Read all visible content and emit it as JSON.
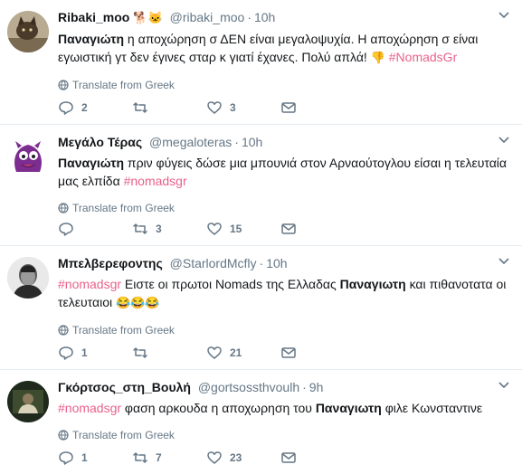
{
  "tweets": [
    {
      "fullname": "Ribaki_moo",
      "fullname_emoji": "🐕🐱",
      "handle": "@ribaki_moo",
      "separator": "·",
      "time": "10h",
      "text_bold_prefix": "Παναγιώτη",
      "text_main": " η αποχώρηση σ ΔΕΝ είναι μεγαλοψυχία. Η αποχώρηση σ είναι εγωιστική γτ δεν έγινες σταρ κ γιατί έχανες.  Πολύ απλά!  ",
      "text_emoji": "👎",
      "hashtag": " #NomadsGr",
      "translate": "Translate from Greek",
      "replies": "2",
      "retweets": "",
      "likes": "3"
    },
    {
      "fullname": "Μεγάλο Τέρας",
      "fullname_emoji": "",
      "handle": "@megaloteras",
      "separator": "·",
      "time": "10h",
      "text_bold_prefix": "Παναγιώτη",
      "text_main": " πριν φύγεις δώσε μια μπουνιά στον Αρναούτογλου είσαι η τελευταία μας ελπίδα ",
      "hashtag": "#nomadsgr",
      "translate": "Translate from Greek",
      "replies": "",
      "retweets": "3",
      "likes": "15"
    },
    {
      "fullname": "Μπελβερεφοντης",
      "fullname_emoji": "",
      "handle": "@StarlordMcfly",
      "separator": "·",
      "time": "10h",
      "hashtag": "#nomadsgr",
      "text_a": " Ειστε οι πρωτοι Nomads της Ελλαδας ",
      "text_bold": "Παναγιωτη",
      "text_b": " και πιθανοτατα οι τελευταιοι ",
      "text_emoji": "😂😂😂",
      "translate": "Translate from Greek",
      "replies": "1",
      "retweets": "",
      "likes": "21"
    },
    {
      "fullname": "Γκόρτσος_στη_Βουλή",
      "fullname_emoji": "",
      "handle": "@gortsossthvoulh",
      "separator": "·",
      "time": "9h",
      "hashtag": "#nomadsgr",
      "text_a": " φαση αρκουδα η αποχωρηση του ",
      "text_bold": "Παναγιωτη",
      "text_b": " φιλε Κωνσταντινε",
      "translate": "Translate from Greek",
      "replies": "1",
      "retweets": "7",
      "likes": "23"
    }
  ],
  "icons": {
    "reply": "reply-icon",
    "retweet": "retweet-icon",
    "like": "heart-icon",
    "message": "envelope-icon",
    "translate": "globe-icon",
    "caret": "chevron-down-icon"
  },
  "colors": {
    "hashtag": "#e0245e",
    "secondary_text": "#657786",
    "border": "#e6ecf0"
  }
}
